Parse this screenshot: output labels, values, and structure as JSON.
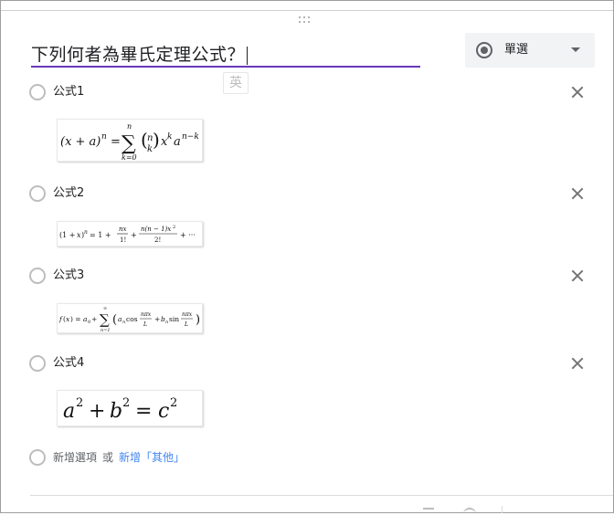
{
  "question": {
    "title": "下列何者為畢氏定理公式？",
    "ime_indicator": "英"
  },
  "type_selector": {
    "label": "單選",
    "icon": "radio-button-icon"
  },
  "options": [
    {
      "label": "公式1",
      "formula_text": "(x + a)^n = Σ_{k=0}^{n} (n choose k) x^k a^{n−k}"
    },
    {
      "label": "公式2",
      "formula_text": "(1 + x)^n = 1 + nx/1! + n(n − 1)x^2/2! + ···"
    },
    {
      "label": "公式3",
      "formula_text": "f(x) = a_0 + Σ_{n=1}^{∞} (a_n cos(nπx/L) + b_n sin(nπx/L))"
    },
    {
      "label": "公式4",
      "formula_text": "a^2 + b^2 = c^2"
    }
  ],
  "add_option": {
    "add_label": "新增選項",
    "or_label": "或",
    "add_other_label": "新增「其他」"
  },
  "colors": {
    "accent": "#673ab7",
    "link": "#4285f4",
    "icon": "#757575"
  }
}
